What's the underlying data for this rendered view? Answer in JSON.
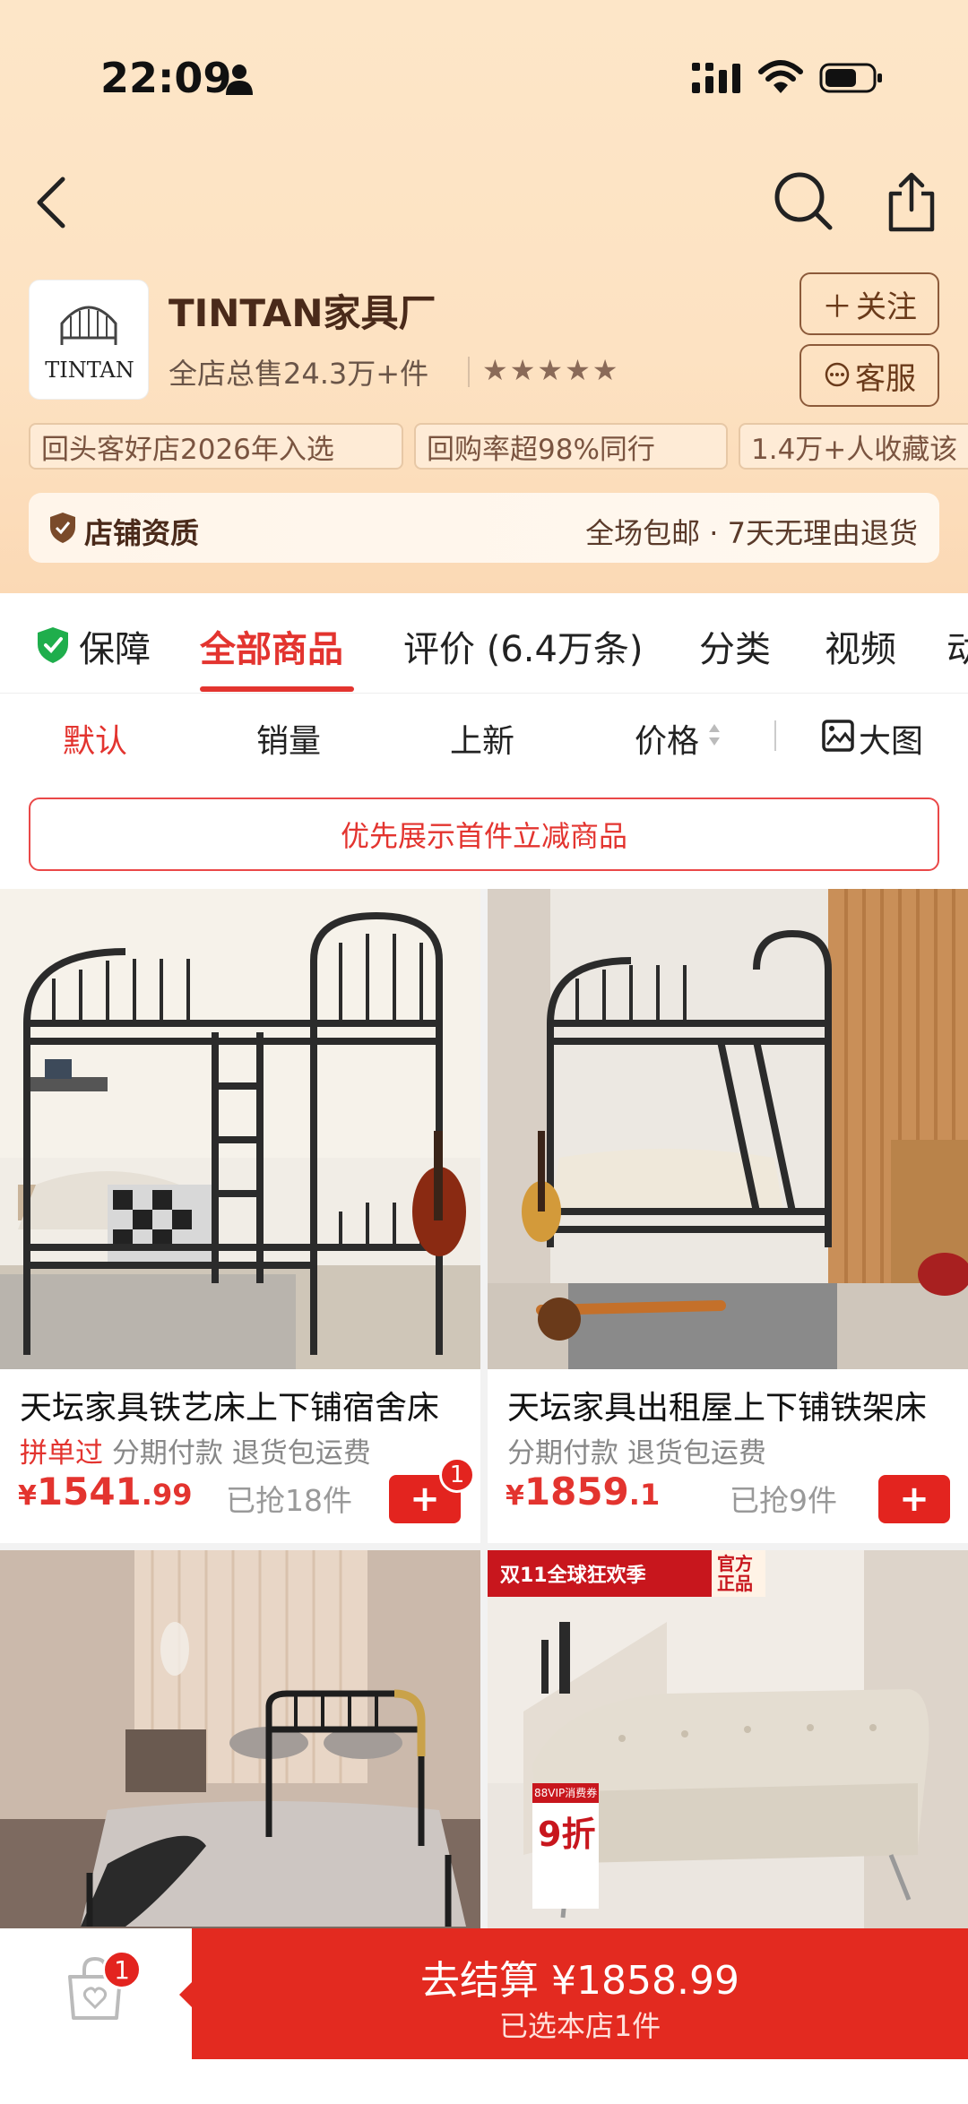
{
  "status_bar": {
    "time": "22:09"
  },
  "store": {
    "logo_text": "TINTAN",
    "name": "TINTAN家具厂",
    "sales": "全店总售24.3万+件",
    "rating_stars": 5,
    "follow_label": "关注",
    "service_label": "客服"
  },
  "chips": [
    {
      "text": "回头客好店2026年入选"
    },
    {
      "text": "回购率超98%同行"
    },
    {
      "text": "1.4万+人收藏该"
    }
  ],
  "qualification": {
    "left": "店铺资质",
    "right": "全场包邮 · 7天无理由退货"
  },
  "tabs": [
    {
      "label": "保障"
    },
    {
      "label": "全部商品",
      "active": true
    },
    {
      "label": "评价 (6.4万条)"
    },
    {
      "label": "分类"
    },
    {
      "label": "视频"
    },
    {
      "label": "动"
    }
  ],
  "sort": [
    {
      "label": "默认",
      "active": true
    },
    {
      "label": "销量"
    },
    {
      "label": "上新"
    },
    {
      "label": "价格"
    },
    {
      "label": "大图"
    }
  ],
  "promo_banner": "优先展示首件立减商品",
  "products": [
    {
      "title": "天坛家具铁艺床上下铺宿舍床",
      "tag_red": "拼单过",
      "tags": "分期付款  退货包运费",
      "price_currency": "¥",
      "price_int": "1541",
      "price_dec": ".99",
      "sold": "已抢18件",
      "cart_count": "1",
      "add_label": "+"
    },
    {
      "title": "天坛家具出租屋上下铺铁架床",
      "tag_red": "",
      "tags": "分期付款  退货包运费",
      "price_currency": "¥",
      "price_int": "1859",
      "price_dec": ".1",
      "sold": "已抢9件",
      "add_label": "+"
    },
    {
      "title": "",
      "image": "black metal single bed"
    },
    {
      "banner_text": "双11全球狂欢季",
      "official_text": "官方正品",
      "coupon_big": "9折",
      "coupon_small": "88VIP消费券",
      "image": "beige sofa bed"
    }
  ],
  "checkout": {
    "main": "去结算 ¥1858.99",
    "sub": "已选本店1件",
    "cart_badge": "1"
  },
  "colors": {
    "accent": "#e3342f",
    "header_bg": "#fde6c8",
    "brown": "#6a3a1a"
  }
}
